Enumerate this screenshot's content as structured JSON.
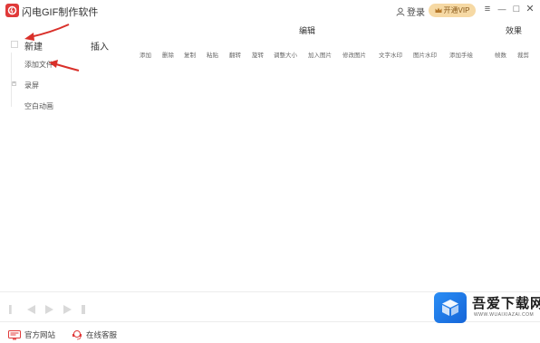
{
  "app": {
    "title": "闪电GIF制作软件",
    "login_label": "登录",
    "vip_label": "开通VIP"
  },
  "window_controls": {
    "menu": "≡",
    "minimize": "—",
    "maximize": "□",
    "close": "✕"
  },
  "sidebar": {
    "tab_new": "新建",
    "tab_import": "插入",
    "items": [
      {
        "label": "添加文件"
      },
      {
        "label": "录屏"
      },
      {
        "label": "空白动画"
      }
    ]
  },
  "main": {
    "section_edit": "编辑",
    "section_effect": "效果",
    "columns": [
      "添加",
      "删除",
      "复制",
      "粘贴",
      "翻转",
      "旋转",
      "调整大小",
      "加入图片",
      "修改图片",
      "文字水印",
      "图片水印",
      "添加手绘",
      "帧数",
      "裁剪"
    ]
  },
  "footer": {
    "website_label": "官方网站",
    "service_label": "在线客服"
  },
  "watermark": {
    "title": "吾爱下载网",
    "subtitle": "WWW.WUAIXIAZAI.COM"
  },
  "colors": {
    "brand_red": "#e03a3a",
    "vip_gold": "#f6d9a4",
    "annotation_arrow": "#d9302a",
    "watermark_blue": "#1e7be8"
  }
}
